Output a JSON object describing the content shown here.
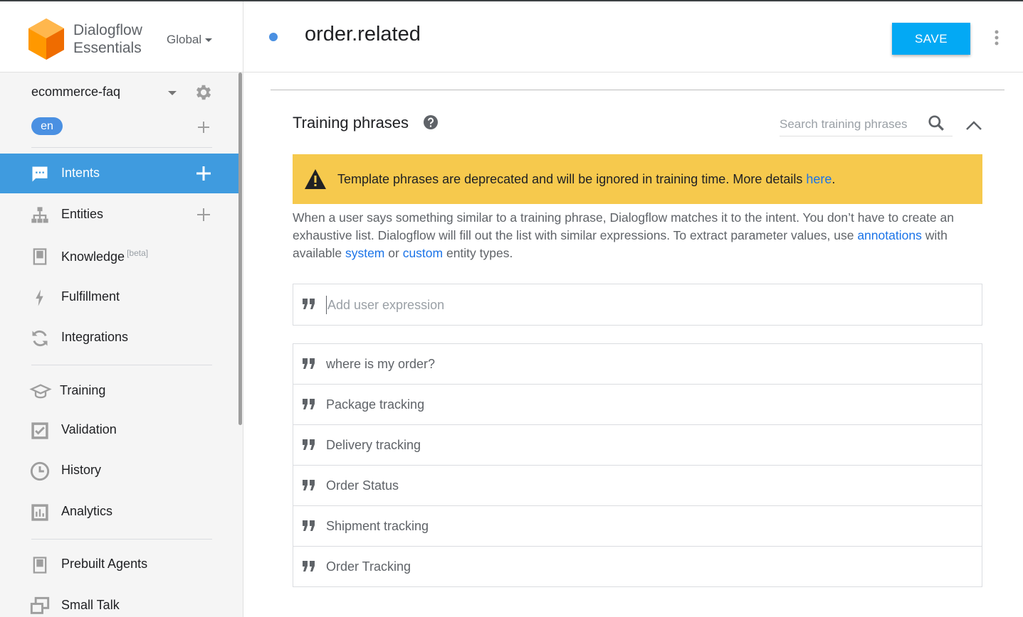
{
  "app": {
    "brand_line1": "Dialogflow",
    "brand_line2": "Essentials",
    "region": "Global"
  },
  "agent": {
    "name": "ecommerce-faq",
    "language": "en"
  },
  "sidebar": {
    "items": [
      {
        "label": "Intents",
        "icon": "chat-icon",
        "active": true,
        "has_add": true
      },
      {
        "label": "Entities",
        "icon": "hierarchy-icon",
        "has_add": true
      },
      {
        "label": "Knowledge",
        "icon": "book-icon",
        "badge": "[beta]"
      },
      {
        "label": "Fulfillment",
        "icon": "bolt-icon"
      },
      {
        "label": "Integrations",
        "icon": "sync-icon"
      },
      {
        "label": "Training",
        "icon": "graduation-cap-icon"
      },
      {
        "label": "Validation",
        "icon": "checkbox-icon"
      },
      {
        "label": "History",
        "icon": "clock-icon"
      },
      {
        "label": "Analytics",
        "icon": "bar-chart-icon"
      },
      {
        "label": "Prebuilt Agents",
        "icon": "book-icon"
      },
      {
        "label": "Small Talk",
        "icon": "chat-bubbles-icon"
      }
    ]
  },
  "header": {
    "intent_name": "order.related",
    "save_label": "SAVE"
  },
  "training": {
    "title": "Training phrases",
    "search_placeholder": "Search training phrases",
    "warning_text": "Template phrases are deprecated and will be ignored in training time. More details ",
    "warning_link": "here",
    "warning_end": ".",
    "desc_part1": "When a user says something similar to a training phrase, Dialogflow matches it to the intent. You don’t have to create an exhaustive list. Dialogflow will fill out the list with similar expressions. To extract parameter values, use ",
    "desc_link_annotations": "annotations",
    "desc_part2": " with available ",
    "desc_link_system": "system",
    "desc_part3": " or ",
    "desc_link_custom": "custom",
    "desc_part4": " entity types.",
    "add_placeholder": "Add user expression",
    "phrases": [
      "where is my order?",
      "Package tracking",
      "Delivery tracking",
      "Order Status",
      "Shipment tracking",
      "Order Tracking"
    ]
  },
  "colors": {
    "active_nav": "#3f9bdf",
    "save_button": "#03a9f4",
    "warning_bg": "#f6c94d",
    "link": "#1a73e8",
    "logo_orange": "#ff9800"
  }
}
